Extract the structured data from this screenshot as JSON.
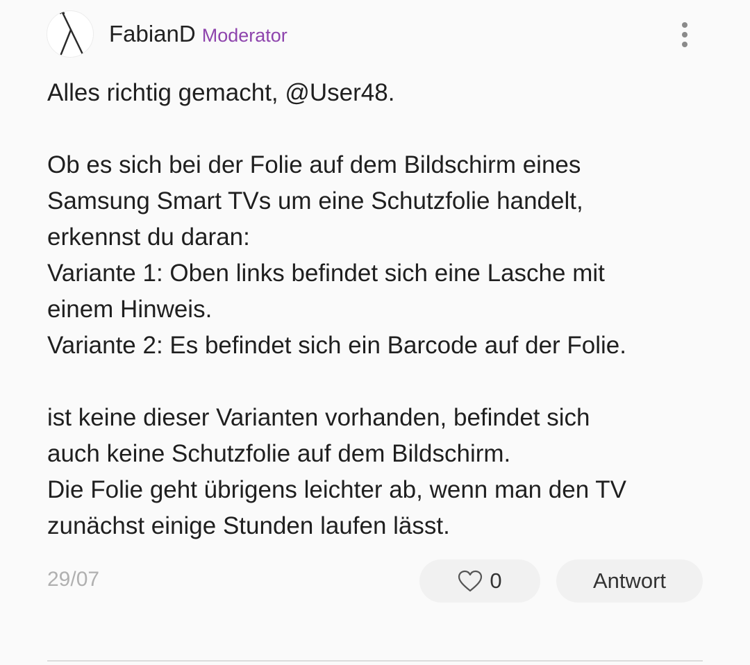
{
  "post": {
    "author": {
      "name": "FabianD",
      "role": "Moderator",
      "avatar_icon": "walking-cane-icon"
    },
    "menu_icon": "more-vertical-icon",
    "body_lines": [
      "Alles richtig gemacht, @User48.",
      "",
      "Ob es sich bei der Folie auf dem Bildschirm eines",
      "Samsung Smart TVs um eine Schutzfolie handelt,",
      "erkennst du daran:",
      "Variante 1: Oben links befindet sich eine Lasche mit",
      "einem Hinweis.",
      "Variante 2: Es befindet sich ein Barcode auf der Folie.",
      "",
      "ist keine dieser Varianten vorhanden, befindet sich",
      "auch keine Schutzfolie auf dem Bildschirm.",
      "Die Folie geht übrigens leichter ab, wenn man den TV",
      "zunächst einige Stunden laufen lässt."
    ],
    "date": "29/07",
    "likes": {
      "icon": "heart-outline-icon",
      "count": "0"
    },
    "reply_label": "Antwort"
  },
  "colors": {
    "background": "#fafafa",
    "moderator": "#8e44ad",
    "text": "#1f1f1f",
    "muted": "#b0b0b0",
    "pill": "#f1f1f1"
  }
}
